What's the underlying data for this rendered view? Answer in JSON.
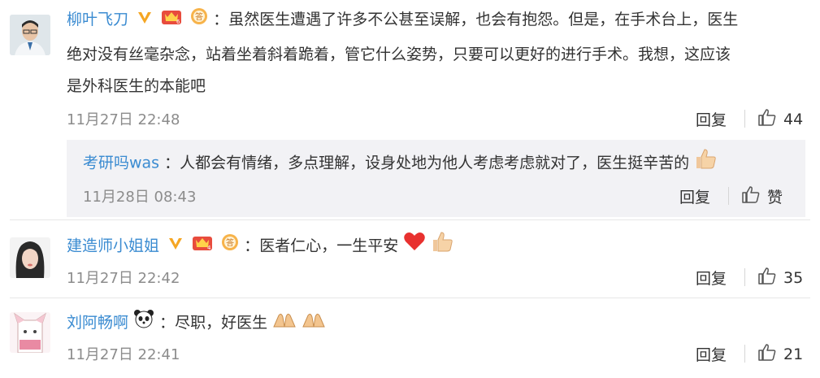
{
  "comments": [
    {
      "user": "柳叶飞刀",
      "text_line1": "：虽然医生遭遇了许多不公甚至误解，也会有抱怨。但是，在手术台上，医生",
      "text_line2": "绝对没有丝毫杂念，站着坐着斜着跪着，管它什么姿势，只要可以更好的进行手术。我想，这应该",
      "text_line3": "是外科医生的本能吧",
      "time": "11月27日 22:48",
      "reply_label": "回复",
      "likes": "44",
      "reply": {
        "user": "考研吗was",
        "text": "：人都会有情绪，多点理解，设身处地为他人考虑考虑就对了，医生挺辛苦的",
        "time": "11月28日 08:43",
        "reply_label": "回复",
        "like_label": "赞"
      }
    },
    {
      "user": "建造师小姐姐",
      "text": "：医者仁心，一生平安",
      "time": "11月27日 22:42",
      "reply_label": "回复",
      "likes": "35"
    },
    {
      "user": "刘阿畅啊",
      "text": "：尽职，好医生",
      "time": "11月27日 22:41",
      "reply_label": "回复",
      "likes": "21"
    }
  ],
  "colors": {
    "username": "#3a8bd1",
    "meta": "#8c8c8c",
    "reply_bg": "#f2f2f5",
    "badge_v": "#f5a623"
  },
  "icons": [
    "verified-v-icon",
    "crown-level-icon",
    "answer-badge-icon",
    "thumbs-up-icon",
    "thumbs-up-emoji",
    "red-heart-emoji",
    "praying-hands-emoji",
    "panda-emoji"
  ]
}
